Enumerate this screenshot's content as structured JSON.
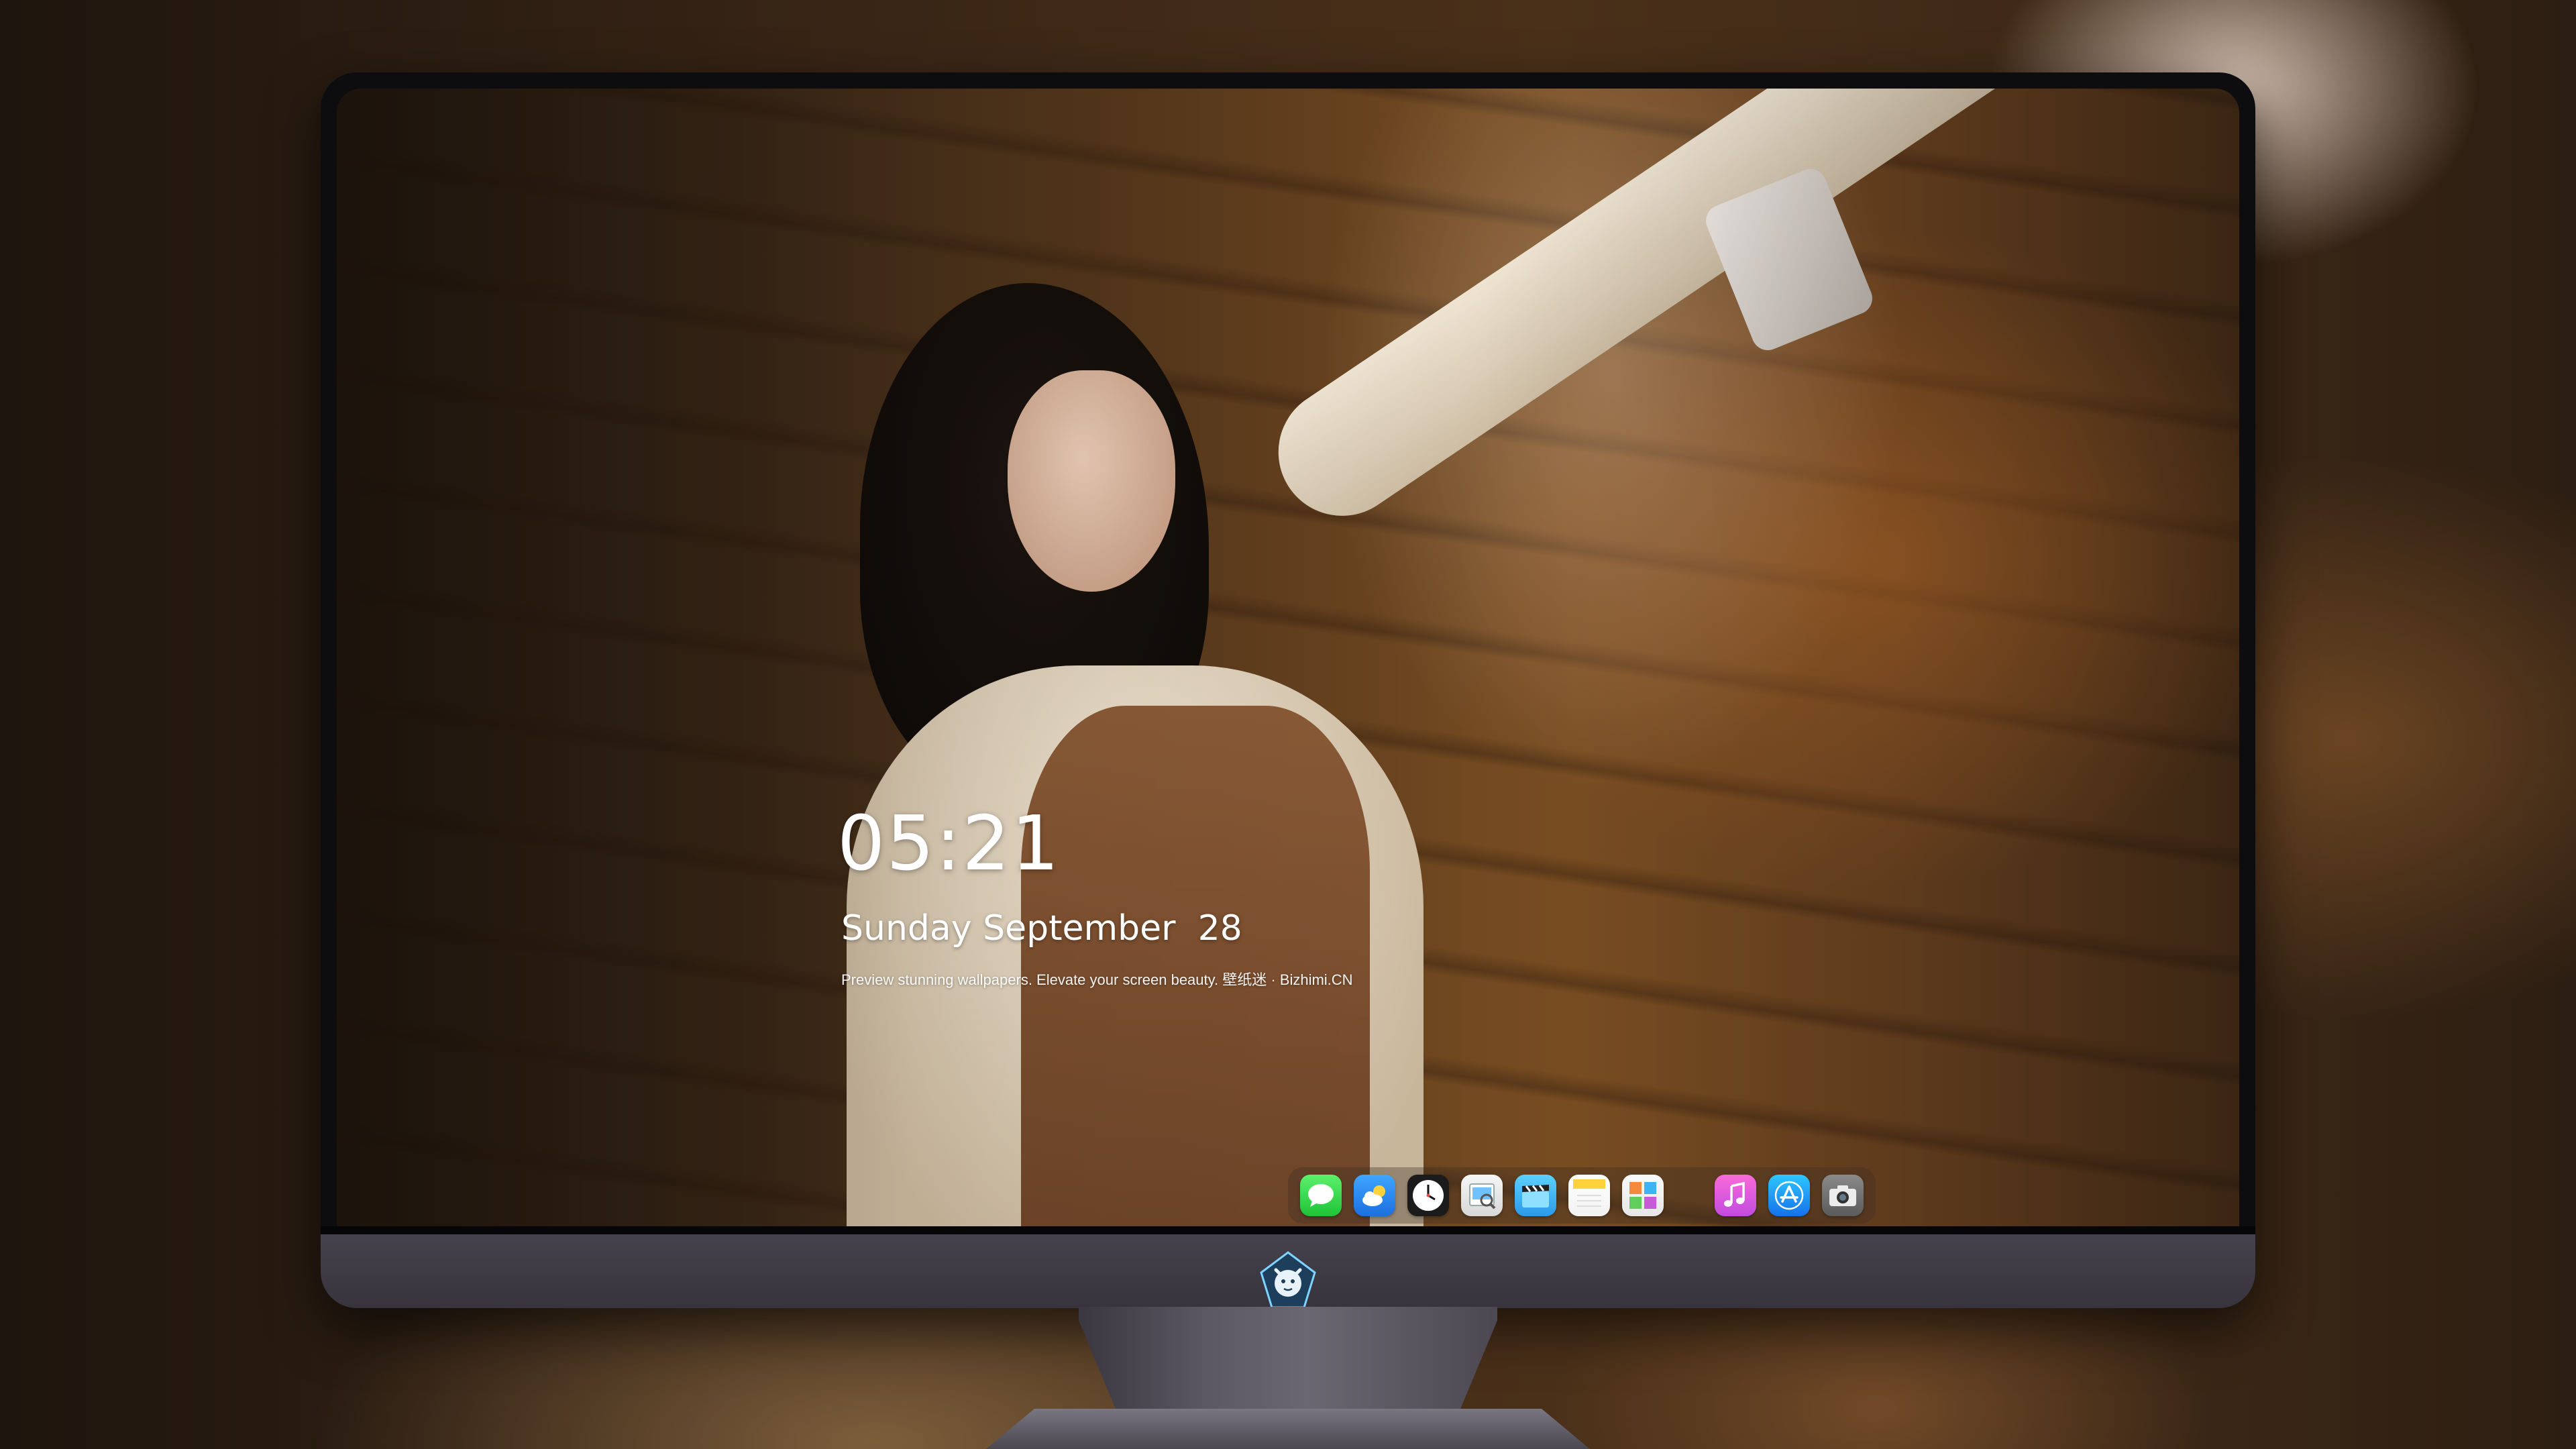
{
  "lock_screen": {
    "time": "05:21",
    "date": "Sunday September  28",
    "tagline": "Preview stunning wallpapers. Elevate your screen beauty. 壁纸迷 · Bizhimi.CN"
  },
  "dock": {
    "items": [
      {
        "id": "messages",
        "icon": "messages-icon",
        "color": "#28c840"
      },
      {
        "id": "weather",
        "icon": "weather-icon",
        "color": "#2a8cf6"
      },
      {
        "id": "clock",
        "icon": "clock-icon",
        "color": "#1b1b1b"
      },
      {
        "id": "preview",
        "icon": "preview-icon",
        "color": "#e8e8e8"
      },
      {
        "id": "clips",
        "icon": "clapperboard-icon",
        "color": "#3cb4f4"
      },
      {
        "id": "notes",
        "icon": "notes-icon",
        "color": "#ffd23c"
      },
      {
        "id": "photos",
        "icon": "photo-booth-icon",
        "color": "#f0f0f0"
      },
      {
        "id": "music",
        "icon": "music-note-icon",
        "color": "#e25cd9"
      },
      {
        "id": "app-store",
        "icon": "app-store-icon",
        "color": "#1a8cf4"
      },
      {
        "id": "camera",
        "icon": "camera-icon",
        "color": "#6d6d6d"
      }
    ]
  },
  "colors": {
    "chin": "#3f3c46",
    "bezel": "#0d0c0f",
    "text": "#ffffff"
  }
}
